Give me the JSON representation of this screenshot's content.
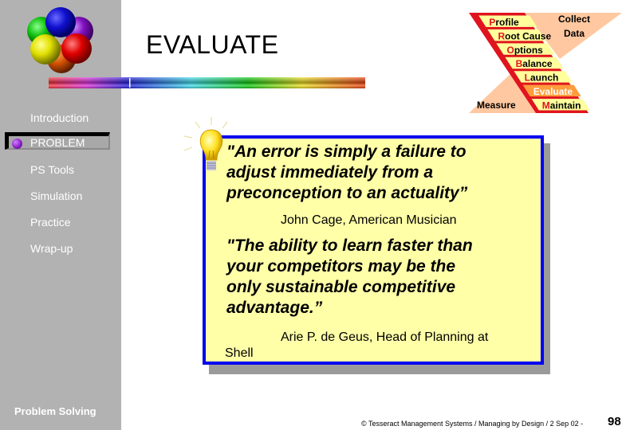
{
  "slide": {
    "title": "EVALUATE",
    "footer_left": "Problem Solving",
    "copyright": "© Tesseract Management Systems / Managing by Design / 2 Sep 02  -",
    "page_number": "98"
  },
  "sidebar": {
    "items": [
      {
        "label": "Introduction",
        "active": false
      },
      {
        "label": "PROBLEM",
        "active": true
      },
      {
        "label": "PS Tools",
        "active": false
      },
      {
        "label": "Simulation",
        "active": false
      },
      {
        "label": "Practice",
        "active": false
      },
      {
        "label": "Wrap-up",
        "active": false
      }
    ]
  },
  "problem_diagram": {
    "steps": [
      {
        "initial": "P",
        "rest": "rofile"
      },
      {
        "initial": "R",
        "rest": "oot Cause"
      },
      {
        "initial": "O",
        "rest": "ptions"
      },
      {
        "initial": "B",
        "rest": "alance"
      },
      {
        "initial": "L",
        "rest": "aunch"
      },
      {
        "initial": "E",
        "rest": "valuate",
        "highlighted": true
      },
      {
        "initial": "M",
        "rest": "aintain"
      }
    ],
    "collect_label_1": "Collect",
    "collect_label_2": "Data",
    "measure_label": "Measure",
    "colors": {
      "border": "#e0141e",
      "band": "#ffff9c",
      "highlight": "#ff9c3c",
      "triangle": "#ffc8a0"
    }
  },
  "quotes": {
    "quote1_lines": [
      "\"An error is simply a failure to",
      "adjust immediately from a",
      "preconception to an actuality”"
    ],
    "attribution1": "John Cage, American Musician",
    "quote2_lines": [
      "\"The ability to learn faster than",
      "your competitors may be the",
      "only sustainable competitive",
      "advantage.”"
    ],
    "attribution2_line1": "Arie P. de Geus, Head of Planning at",
    "attribution2_line2": "Shell",
    "colors": {
      "background": "#ffffa8",
      "border": "#0000f0"
    }
  }
}
